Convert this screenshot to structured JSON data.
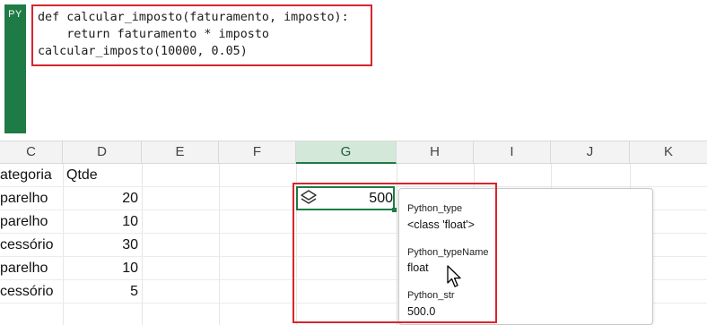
{
  "formula_bar": {
    "badge": "PY",
    "code_lines": [
      "def calcular_imposto(faturamento, imposto):",
      "    return faturamento * imposto",
      "calcular_imposto(10000, 0.05)"
    ]
  },
  "columns": [
    "C",
    "D",
    "E",
    "F",
    "G",
    "H",
    "I",
    "J",
    "K"
  ],
  "active_column": "G",
  "table": {
    "header": {
      "categoria": "ategoria",
      "qtde": "Qtde"
    },
    "rows": [
      {
        "categoria": "parelho",
        "qtde": "20"
      },
      {
        "categoria": "parelho",
        "qtde": "10"
      },
      {
        "categoria": "cessório",
        "qtde": "30"
      },
      {
        "categoria": "parelho",
        "qtde": "10"
      },
      {
        "categoria": "cessório",
        "qtde": "5"
      }
    ]
  },
  "active_cell": {
    "icon": "stack-layers-icon",
    "value": "500"
  },
  "result_card": {
    "items": [
      {
        "label": "Python_type",
        "value": "<class 'float'>"
      },
      {
        "label": "Python_typeName",
        "value": "float"
      },
      {
        "label": "Python_str",
        "value": "500.0"
      }
    ]
  },
  "colors": {
    "python_green": "#1f7b45",
    "highlight_red": "#d6262d",
    "selected_header": "#d3e8d9"
  }
}
